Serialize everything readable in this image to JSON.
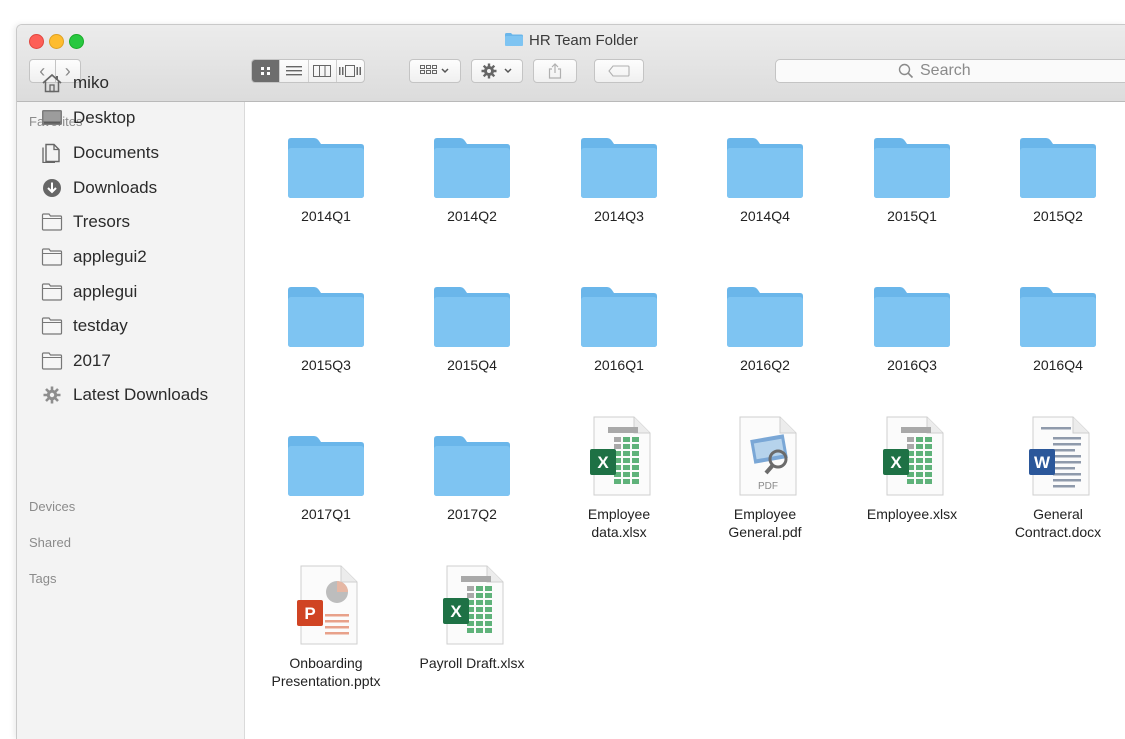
{
  "window": {
    "title": "HR Team Folder"
  },
  "toolbar": {
    "back_symbol": "‹",
    "forward_symbol": "›",
    "search_placeholder": "Search"
  },
  "sidebar": {
    "favorites_heading": "Favorites",
    "items": [
      {
        "label": "miko",
        "icon": "home-icon"
      },
      {
        "label": "Desktop",
        "icon": "desktop-icon"
      },
      {
        "label": "Documents",
        "icon": "documents-icon"
      },
      {
        "label": "Downloads",
        "icon": "downloads-icon"
      },
      {
        "label": "Tresors",
        "icon": "folder-icon"
      },
      {
        "label": "applegui2",
        "icon": "folder-icon"
      },
      {
        "label": "applegui",
        "icon": "folder-icon"
      },
      {
        "label": "testday",
        "icon": "folder-icon"
      },
      {
        "label": "2017",
        "icon": "folder-icon"
      },
      {
        "label": "Latest Downloads",
        "icon": "gear-icon"
      }
    ],
    "devices_heading": "Devices",
    "shared_heading": "Shared",
    "tags_heading": "Tags"
  },
  "files": [
    {
      "name": "2014Q1",
      "kind": "folder"
    },
    {
      "name": "2014Q2",
      "kind": "folder"
    },
    {
      "name": "2014Q3",
      "kind": "folder"
    },
    {
      "name": "2014Q4",
      "kind": "folder"
    },
    {
      "name": "2015Q1",
      "kind": "folder"
    },
    {
      "name": "2015Q2",
      "kind": "folder"
    },
    {
      "name": "2015Q3",
      "kind": "folder"
    },
    {
      "name": "2015Q4",
      "kind": "folder"
    },
    {
      "name": "2016Q1",
      "kind": "folder"
    },
    {
      "name": "2016Q2",
      "kind": "folder"
    },
    {
      "name": "2016Q3",
      "kind": "folder"
    },
    {
      "name": "2016Q4",
      "kind": "folder"
    },
    {
      "name": "2017Q1",
      "kind": "folder"
    },
    {
      "name": "2017Q2",
      "kind": "folder"
    },
    {
      "name": "Employee\ndata.xlsx",
      "kind": "excel"
    },
    {
      "name": "Employee\nGeneral.pdf",
      "kind": "pdf",
      "badge": "PDF"
    },
    {
      "name": "Employee.xlsx",
      "kind": "excel"
    },
    {
      "name": "General\nContract.docx",
      "kind": "word"
    },
    {
      "name": "Onboarding\nPresentation.pptx",
      "kind": "powerpoint"
    },
    {
      "name": "Payroll Draft.xlsx",
      "kind": "excel"
    }
  ],
  "icon_letters": {
    "excel": "X",
    "word": "W",
    "powerpoint": "P"
  },
  "colors": {
    "folder": "#7ec4f2",
    "folder_tab": "#6ab6ea",
    "excel": "#1e7145",
    "word": "#2b579a",
    "powerpoint": "#d04423"
  }
}
